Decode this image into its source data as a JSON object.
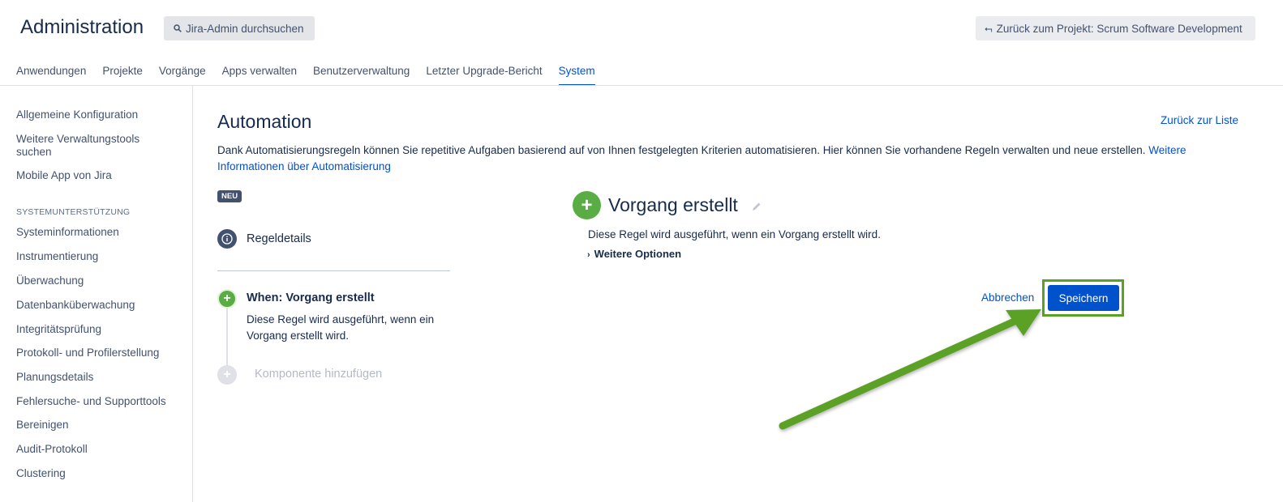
{
  "header": {
    "title": "Administration",
    "search_label": "Jira-Admin durchsuchen",
    "back_project_label": "Zurück zum Projekt: Scrum Software Development"
  },
  "topnav": {
    "tabs": [
      {
        "label": "Anwendungen"
      },
      {
        "label": "Projekte"
      },
      {
        "label": "Vorgänge"
      },
      {
        "label": "Apps verwalten"
      },
      {
        "label": "Benutzerverwaltung"
      },
      {
        "label": "Letzter Upgrade-Bericht"
      },
      {
        "label": "System",
        "active": true
      }
    ]
  },
  "sidebar": {
    "items_top": [
      "Allgemeine Konfiguration",
      "Weitere Verwaltungstools suchen",
      "Mobile App von Jira"
    ],
    "section_title": "SYSTEMUNTERSTÜTZUNG",
    "items_support": [
      "Systeminformationen",
      "Instrumentierung",
      "Überwachung",
      "Datenbanküberwachung",
      "Integritätsprüfung",
      "Protokoll- und Profilerstellung",
      "Planungsdetails",
      "Fehlersuche- und Supporttools",
      "Bereinigen",
      "Audit-Protokoll",
      "Clustering"
    ]
  },
  "main": {
    "title": "Automation",
    "back_to_list": "Zurück zur Liste",
    "description": "Dank Automatisierungsregeln können Sie repetitive Aufgaben basierend auf von Ihnen festgelegten Kriterien automatisieren. Hier können Sie vorhandene Regeln verwalten und neue erstellen. ",
    "description_link": "Weitere Informationen über Automatisierung",
    "badge": "NEU",
    "rule_details_label": "Regeldetails",
    "trigger_title": "When: Vorgang erstellt",
    "trigger_desc": "Diese Regel wird ausgeführt, wenn ein Vorgang erstellt wird.",
    "add_component": "Komponente hinzufügen",
    "editor_title": "Vorgang erstellt",
    "editor_desc": "Diese Regel wird ausgeführt, wenn ein Vorgang erstellt wird.",
    "more_options": "Weitere Optionen",
    "cancel_label": "Abbrechen",
    "save_label": "Speichern"
  },
  "colors": {
    "accent": "#0052cc",
    "green": "#5aac44",
    "annotation_arrow": "#5aa127"
  }
}
